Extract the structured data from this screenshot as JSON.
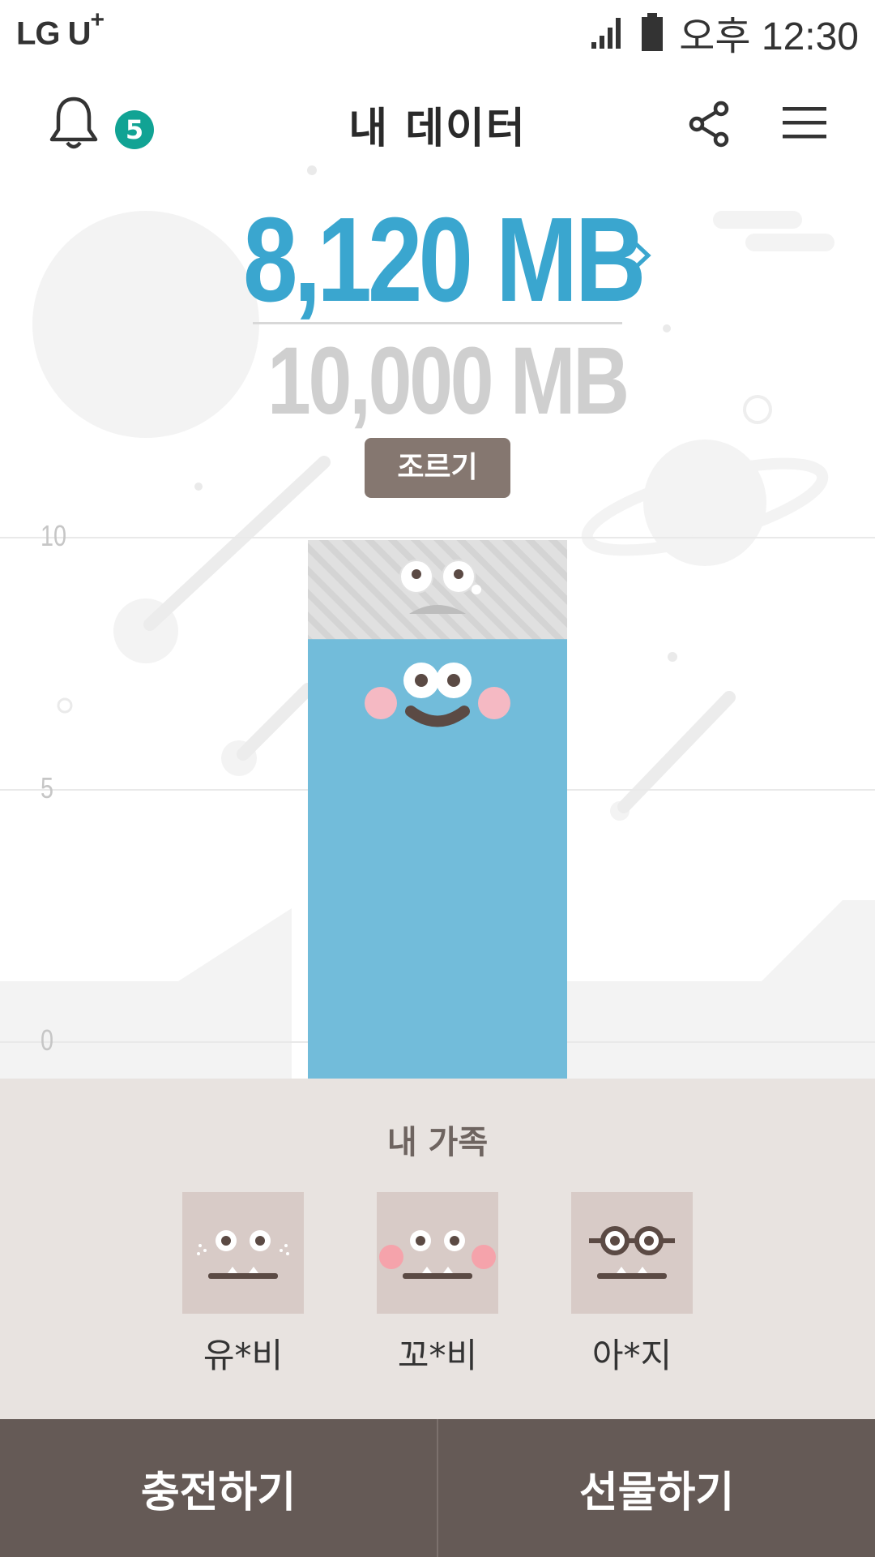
{
  "status_bar": {
    "carrier": "LG U",
    "carrier_plus": "+",
    "time": "오후 12:30"
  },
  "header": {
    "title": "내 데이터",
    "notification_count": "5"
  },
  "usage": {
    "used": "8,120",
    "used_unit": "MB",
    "total": "10,000 MB",
    "save_button": "조르기",
    "used_fraction": 0.812
  },
  "chart_data": {
    "type": "bar",
    "categories": [
      ""
    ],
    "values": [
      8.12
    ],
    "capacity": 10,
    "ylim": [
      0,
      10
    ],
    "yticks": [
      "10",
      "5",
      "0"
    ],
    "colors": {
      "used": "#72bcda",
      "remaining": "#e0e0e0"
    }
  },
  "family": {
    "title": "내 가족",
    "members": [
      {
        "name": "유*비"
      },
      {
        "name": "꼬*비"
      },
      {
        "name": "아*지"
      }
    ]
  },
  "actions": {
    "charge": "충전하기",
    "gift": "선물하기"
  },
  "colors": {
    "accent": "#3aa6cf",
    "badge": "#11a394",
    "button": "#857770",
    "bottom_bar": "#655a56"
  }
}
